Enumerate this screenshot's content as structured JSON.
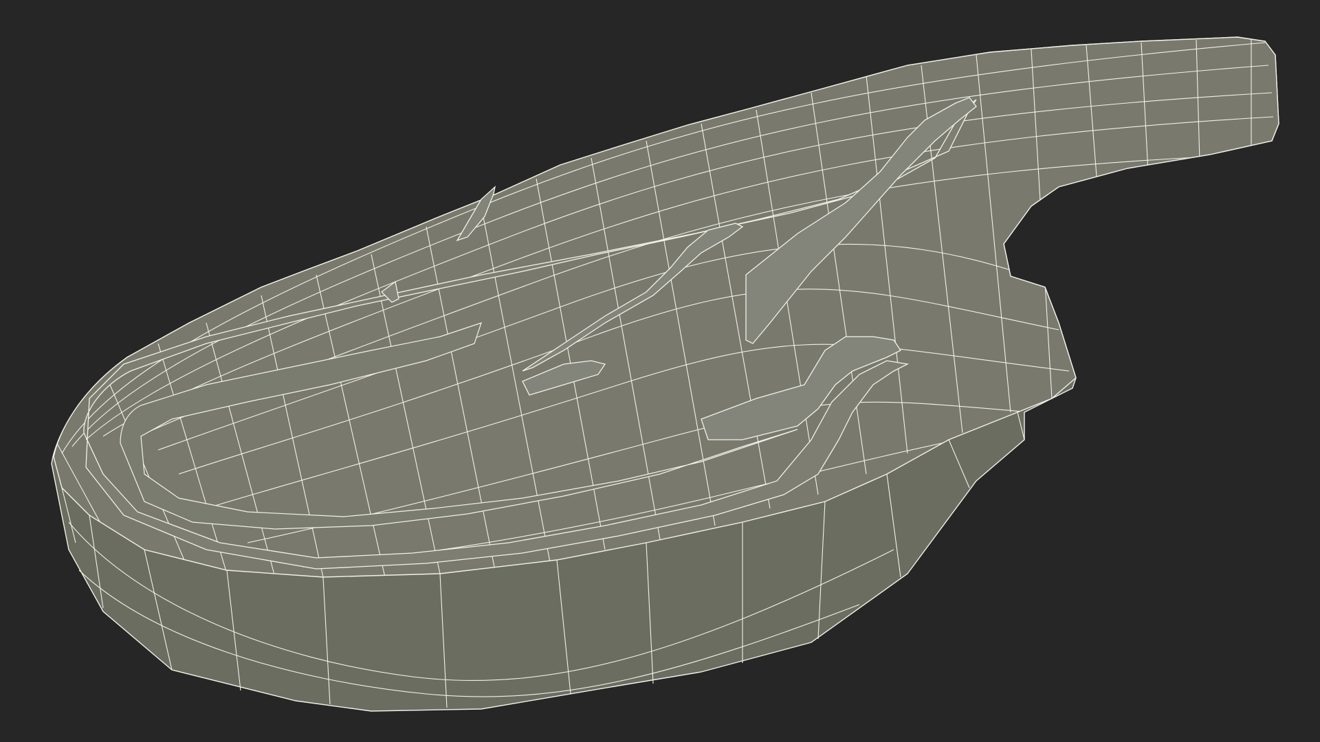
{
  "scene": {
    "background_color": "#262626",
    "mesh_fill": "#797a6d",
    "mesh_fill_dark": "#6c6d61",
    "mesh_fill_light": "#85867a",
    "wire_color": "#f2f2ea",
    "icon": "wireframe-mesh-icon"
  }
}
